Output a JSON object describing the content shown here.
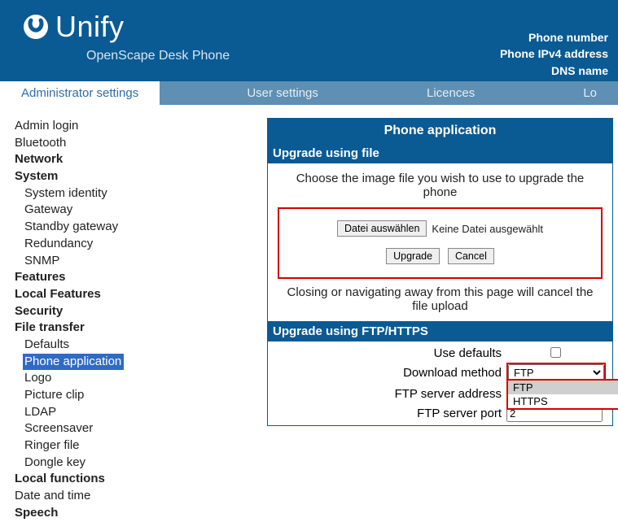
{
  "header": {
    "brand": "Unify",
    "subtitle": "OpenScape Desk Phone",
    "right": {
      "phone_number": "Phone number",
      "ipv4": "Phone IPv4 address",
      "dns": "DNS name"
    }
  },
  "tabs": {
    "admin": "Administrator settings",
    "user": "User settings",
    "licences": "Licences",
    "lo": "Lo"
  },
  "sidebar": {
    "admin_login": "Admin login",
    "bluetooth": "Bluetooth",
    "network": "Network",
    "system": "System",
    "system_items": {
      "identity": "System identity",
      "gateway": "Gateway",
      "standby": "Standby gateway",
      "redundancy": "Redundancy",
      "snmp": "SNMP"
    },
    "features": "Features",
    "local_features": "Local Features",
    "security": "Security",
    "file_transfer": "File transfer",
    "ft_items": {
      "defaults": "Defaults",
      "phone_app": "Phone application",
      "logo": "Logo",
      "picture_clip": "Picture clip",
      "ldap": "LDAP",
      "screensaver": "Screensaver",
      "ringer": "Ringer file",
      "dongle": "Dongle key"
    },
    "local_functions": "Local functions",
    "date_time": "Date and time",
    "speech": "Speech"
  },
  "main": {
    "panel_title": "Phone application",
    "upgrade_file_title": "Upgrade using file",
    "choose_text": "Choose the image file you wish to use to upgrade the phone",
    "file_btn": "Datei auswählen",
    "no_file": "Keine Datei ausgewählt",
    "upgrade_btn": "Upgrade",
    "cancel_btn": "Cancel",
    "closing_note": "Closing or navigating away from this page will cancel the file upload",
    "upgrade_ftp_title": "Upgrade using FTP/HTTPS",
    "labels": {
      "use_defaults": "Use defaults",
      "download_method": "Download method",
      "ftp_addr": "FTP server address",
      "ftp_port": "FTP server port"
    },
    "download_selected": "FTP",
    "download_options": {
      "ftp": "FTP",
      "https": "HTTPS"
    },
    "ftp_port_value": "2"
  }
}
